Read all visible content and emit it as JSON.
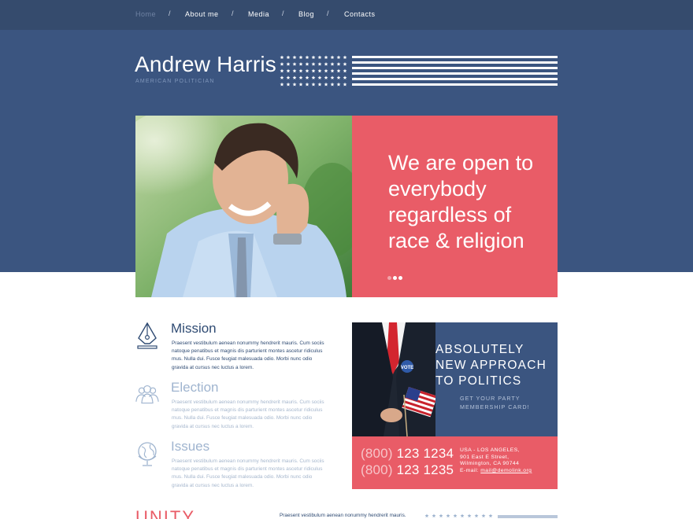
{
  "nav": {
    "items": [
      {
        "label": "Home",
        "active": true
      },
      {
        "label": "About me",
        "active": false
      },
      {
        "label": "Media",
        "active": false
      },
      {
        "label": "Blog",
        "active": false
      },
      {
        "label": "Contacts",
        "active": false
      }
    ],
    "separator": "/"
  },
  "header": {
    "title": "Andrew Harris",
    "subtitle": "AMERICAN POLITICIAN"
  },
  "slider": {
    "heading": "We are open to everybody regardless of race & religion",
    "dots": 3,
    "active_dot": 1
  },
  "features": [
    {
      "icon": "fountain-pen-icon",
      "title": "Mission",
      "body": "Praesent vestibulum aenean nonummy hendrerit mauris. Cum sociis natoque penatibus et magnis dis parturient montes ascetur ridiculus mus. Nulla dui. Fusce feugiat malesuada odio. Morbi nunc odio gravida at cursus nec luctus a lorem."
    },
    {
      "icon": "group-people-icon",
      "title": "Election",
      "body": "Praesent vestibulum aenean nonummy hendrerit mauris. Cum sociis natoque penatibus et magnis dis parturient montes ascetur ridiculus mus. Nulla dui. Fusce feugiat malesuada odio. Morbi nunc odio gravida at cursus nec luctus a lorem."
    },
    {
      "icon": "globe-icon",
      "title": "Issues",
      "body": "Praesent vestibulum aenean nonummy hendrerit mauris. Cum sociis natoque penatibus et magnis dis parturient montes ascetur ridiculus mus. Nulla dui. Fusce feugiat malesuada odio. Morbi nunc odio gravida at cursus nec luctus a lorem."
    }
  ],
  "promo": {
    "heading": "ABSOLUTELY NEW APPROACH TO POLITICS",
    "sub": "GET YOUR PARTY MEMBERSHIP CARD!",
    "badge": "VOTE"
  },
  "contact": {
    "phones": [
      {
        "prefix": "(800)",
        "number": "123 1234"
      },
      {
        "prefix": "(800)",
        "number": "123 1235"
      }
    ],
    "address_line1": "USA - LOS ANGELES,",
    "address_line2": "901 East E Street,",
    "address_line3": "Wilmington, CA 90744",
    "email_label": "E-mail:",
    "email": "mail@demolink.org"
  },
  "bottom": {
    "heading": "UNITY",
    "text": "Praesent vestibulum aenean nonummy hendrerit mauris."
  },
  "colors": {
    "navy": "#354b6d",
    "band": "#3b5580",
    "coral": "#e95c67",
    "text_dark": "#2f4b73",
    "muted": "#a6b7cd"
  }
}
